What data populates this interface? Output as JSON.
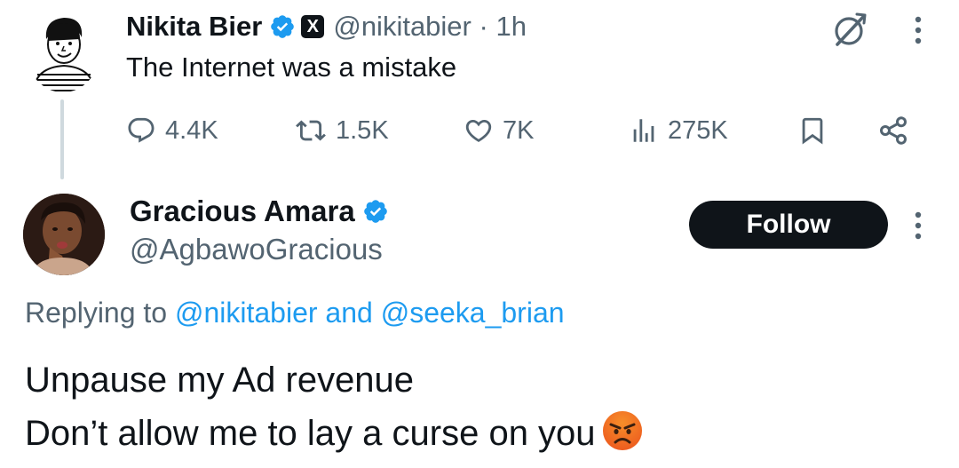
{
  "parent_tweet": {
    "author_name": "Nikita Bier",
    "author_handle": "@nikitabier",
    "separator": "·",
    "time": "1h",
    "x_badge": "X",
    "text": "The Internet was a mistake",
    "stats": {
      "replies": "4.4K",
      "reposts": "1.5K",
      "likes": "7K",
      "views": "275K"
    }
  },
  "reply": {
    "author_name": "Gracious Amara",
    "author_handle": "@AgbawoGracious",
    "follow_label": "Follow",
    "replying_prefix": "Replying to",
    "replying_to_1": "@nikitabier",
    "replying_and": "and",
    "replying_to_2": "@seeka_brian",
    "line1": "Unpause my Ad revenue",
    "line2": "Don’t allow me to lay a curse on you"
  },
  "colors": {
    "text": "#0f1419",
    "secondary": "#536471",
    "link": "#1d9bf0",
    "verified": "#1d9bf0",
    "thread_line": "#cfd9de",
    "follow_bg": "#0f1419"
  },
  "icons": {
    "verified": "verified-badge-icon",
    "x_logo": "x-logo-icon",
    "grok": "grok-icon",
    "more": "more-vertical-icon",
    "reply": "reply-icon",
    "repost": "repost-icon",
    "like": "heart-icon",
    "views": "views-bar-icon",
    "bookmark": "bookmark-icon",
    "share": "share-icon",
    "emoji": "angry-face-emoji"
  }
}
